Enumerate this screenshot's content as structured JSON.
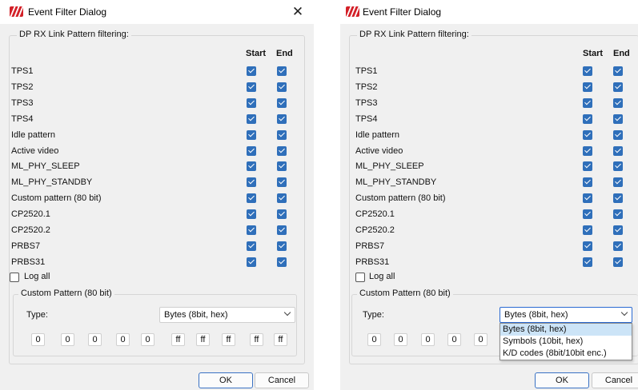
{
  "dialogs": [
    {
      "title": "Event Filter Dialog",
      "close_glyph": "✕",
      "group_title": "DP RX Link Pattern filtering:",
      "col_start": "Start",
      "col_end": "End",
      "rows": [
        {
          "label": "TPS1",
          "start_checked": true,
          "end_checked": true
        },
        {
          "label": "TPS2",
          "start_checked": true,
          "end_checked": true
        },
        {
          "label": "TPS3",
          "start_checked": true,
          "end_checked": true
        },
        {
          "label": "TPS4",
          "start_checked": true,
          "end_checked": true
        },
        {
          "label": "Idle pattern",
          "start_checked": true,
          "end_checked": true
        },
        {
          "label": "Active video",
          "start_checked": true,
          "end_checked": true
        },
        {
          "label": "ML_PHY_SLEEP",
          "start_checked": true,
          "end_checked": true
        },
        {
          "label": "ML_PHY_STANDBY",
          "start_checked": true,
          "end_checked": true
        },
        {
          "label": "Custom pattern (80 bit)",
          "start_checked": true,
          "end_checked": true
        },
        {
          "label": "CP2520.1",
          "start_checked": true,
          "end_checked": true
        },
        {
          "label": "CP2520.2",
          "start_checked": true,
          "end_checked": true
        },
        {
          "label": "PRBS7",
          "start_checked": true,
          "end_checked": true
        },
        {
          "label": "PRBS31",
          "start_checked": true,
          "end_checked": true
        }
      ],
      "log_all_label": "Log all",
      "log_all_checked": false,
      "custom_group_title": "Custom Pattern (80 bit)",
      "type_label": "Type:",
      "type_value": "Bytes (8bit, hex)",
      "hex_values": [
        "0",
        "0",
        "0",
        "0",
        "0",
        "ff",
        "ff",
        "ff",
        "ff",
        "ff"
      ],
      "ok_label": "OK",
      "cancel_label": "Cancel"
    },
    {
      "title": "Event Filter Dialog",
      "group_title": "DP RX Link Pattern filtering:",
      "col_start": "Start",
      "col_end": "End",
      "rows": [
        {
          "label": "TPS1",
          "start_checked": true,
          "end_checked": true
        },
        {
          "label": "TPS2",
          "start_checked": true,
          "end_checked": true
        },
        {
          "label": "TPS3",
          "start_checked": true,
          "end_checked": true
        },
        {
          "label": "TPS4",
          "start_checked": true,
          "end_checked": true
        },
        {
          "label": "Idle pattern",
          "start_checked": true,
          "end_checked": true
        },
        {
          "label": "Active video",
          "start_checked": true,
          "end_checked": true
        },
        {
          "label": "ML_PHY_SLEEP",
          "start_checked": true,
          "end_checked": true
        },
        {
          "label": "ML_PHY_STANDBY",
          "start_checked": true,
          "end_checked": true
        },
        {
          "label": "Custom pattern (80 bit)",
          "start_checked": true,
          "end_checked": true
        },
        {
          "label": "CP2520.1",
          "start_checked": true,
          "end_checked": true
        },
        {
          "label": "CP2520.2",
          "start_checked": true,
          "end_checked": true
        },
        {
          "label": "PRBS7",
          "start_checked": true,
          "end_checked": true
        },
        {
          "label": "PRBS31",
          "start_checked": true,
          "end_checked": true
        }
      ],
      "log_all_label": "Log all",
      "log_all_checked": false,
      "custom_group_title": "Custom Pattern (80 bit)",
      "type_label": "Type:",
      "type_value": "Bytes (8bit, hex)",
      "type_options": [
        "Bytes (8bit, hex)",
        "Symbols (10bit, hex)",
        "K/D codes (8bit/10bit enc.)"
      ],
      "type_dropdown_open": true,
      "hex_values": [
        "0",
        "0",
        "0",
        "0",
        "0"
      ],
      "ok_label": "OK",
      "cancel_label": "Cancel"
    }
  ],
  "colors": {
    "dialog_bg": "#f0f0f0",
    "checkbox_fill": "#2f6fba",
    "brand_logo": "#d32028",
    "focus_border": "#3a72c4",
    "dropdown_highlight": "#cce4f7"
  }
}
